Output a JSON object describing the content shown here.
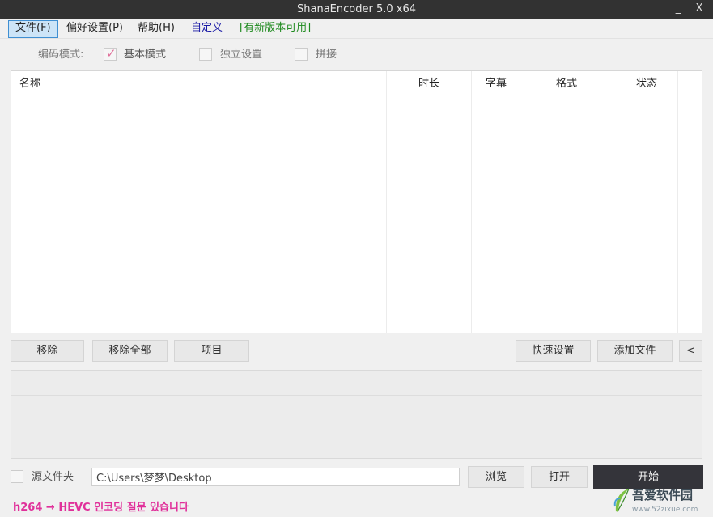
{
  "window": {
    "title": "ShanaEncoder 5.0 x64",
    "minimize": "_",
    "close": "X"
  },
  "menu": {
    "file": "文件(F)",
    "preferences": "偏好设置(P)",
    "help": "帮助(H)",
    "custom": "自定义",
    "update": "[有新版本可用]",
    "colors": {
      "custom": "#1a1aa6",
      "update": "#1f8a1f"
    }
  },
  "mode": {
    "label": "编码模式:",
    "basic": "基本模式",
    "independent": "独立设置",
    "concat": "拼接",
    "basic_checked": true,
    "independent_checked": false,
    "concat_checked": false
  },
  "table": {
    "columns": [
      "名称",
      "时长",
      "字幕",
      "格式",
      "状态"
    ],
    "rows": []
  },
  "buttons": {
    "remove": "移除",
    "remove_all": "移除全部",
    "item": "项目",
    "quick_settings": "快速设置",
    "add_file": "添加文件",
    "expand": "<"
  },
  "bottom": {
    "source_folder_label": "源文件夹",
    "source_folder_checked": false,
    "path": "C:\\Users\\梦梦\\Desktop",
    "browse": "浏览",
    "open": "打开",
    "start": "开始"
  },
  "status": {
    "text": "h264 → HEVC 인코딩 질문 있습니다",
    "color": "#e0309a"
  },
  "watermark": {
    "main": "吾爱软件园",
    "sub": "www.52zixue.com",
    "icon": "leaf-pen-icon"
  }
}
